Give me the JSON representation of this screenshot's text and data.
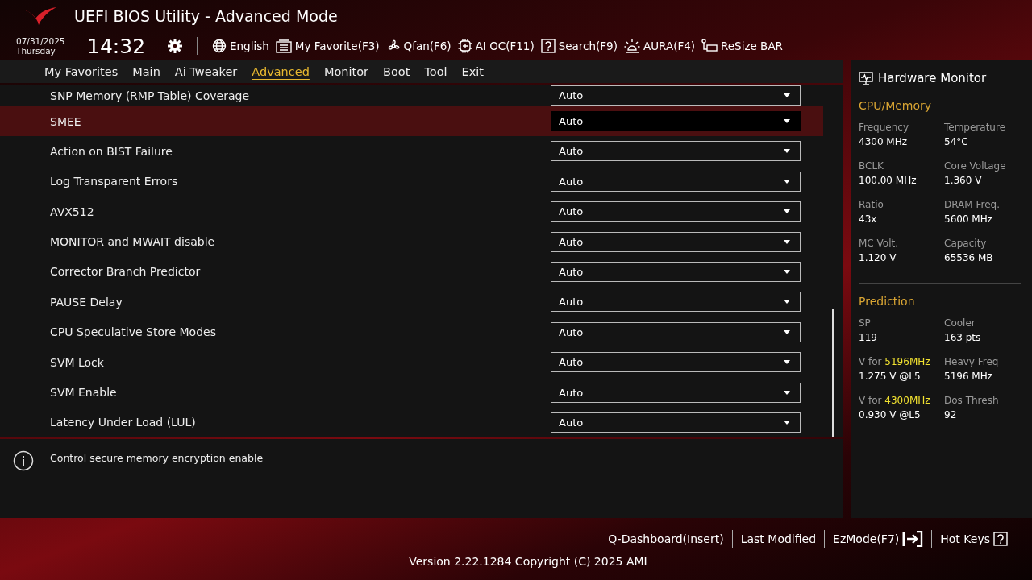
{
  "header": {
    "title": "UEFI BIOS Utility - Advanced Mode",
    "date": "07/31/2025",
    "day": "Thursday",
    "time": "14:32",
    "tools": [
      {
        "kind": "globe",
        "label": "English"
      },
      {
        "kind": "favorite",
        "label": "My Favorite(F3)"
      },
      {
        "kind": "fan",
        "label": "Qfan(F6)"
      },
      {
        "kind": "chip",
        "label": "AI OC(F11)"
      },
      {
        "kind": "help",
        "label": "Search(F9)"
      },
      {
        "kind": "light",
        "label": "AURA(F4)"
      },
      {
        "kind": "card",
        "label": "ReSize BAR"
      }
    ]
  },
  "tabs": [
    {
      "label": "My Favorites",
      "selected": false
    },
    {
      "label": "Main",
      "selected": false
    },
    {
      "label": "Ai Tweaker",
      "selected": false
    },
    {
      "label": "Advanced",
      "selected": true
    },
    {
      "label": "Monitor",
      "selected": false
    },
    {
      "label": "Boot",
      "selected": false
    },
    {
      "label": "Tool",
      "selected": false
    },
    {
      "label": "Exit",
      "selected": false
    }
  ],
  "settings": [
    {
      "label": "SNP Memory (RMP Table) Coverage",
      "value": "Auto",
      "selected": false
    },
    {
      "label": "SMEE",
      "value": "Auto",
      "selected": true
    },
    {
      "label": "Action on BIST Failure",
      "value": "Auto",
      "selected": false
    },
    {
      "label": "Log Transparent Errors",
      "value": "Auto",
      "selected": false
    },
    {
      "label": "AVX512",
      "value": "Auto",
      "selected": false
    },
    {
      "label": "MONITOR and MWAIT disable",
      "value": "Auto",
      "selected": false
    },
    {
      "label": "Corrector Branch Predictor",
      "value": "Auto",
      "selected": false
    },
    {
      "label": "PAUSE Delay",
      "value": "Auto",
      "selected": false
    },
    {
      "label": "CPU Speculative Store Modes",
      "value": "Auto",
      "selected": false
    },
    {
      "label": "SVM Lock",
      "value": "Auto",
      "selected": false
    },
    {
      "label": "SVM Enable",
      "value": "Auto",
      "selected": false
    },
    {
      "label": "Latency Under Load (LUL)",
      "value": "Auto",
      "selected": false
    }
  ],
  "help_text": "Control secure memory encryption enable",
  "hardware_monitor": {
    "title": "Hardware Monitor",
    "sections": [
      {
        "title": "CPU/Memory",
        "items": [
          {
            "label": "Frequency",
            "value": "4300 MHz"
          },
          {
            "label": "Temperature",
            "value": "54°C"
          },
          {
            "label": "BCLK",
            "value": "100.00 MHz"
          },
          {
            "label": "Core Voltage",
            "value": "1.360 V"
          },
          {
            "label": "Ratio",
            "value": "43x"
          },
          {
            "label": "DRAM Freq.",
            "value": "5600 MHz"
          },
          {
            "label": "MC Volt.",
            "value": "1.120 V"
          },
          {
            "label": "Capacity",
            "value": "65536 MB"
          }
        ]
      },
      {
        "title": "Prediction",
        "items": [
          {
            "label": "SP",
            "value": "119"
          },
          {
            "label": "Cooler",
            "value": "163 pts"
          },
          {
            "label": "V for **5196MHz**",
            "value": "1.275 V @L5"
          },
          {
            "label": "Heavy Freq",
            "value": "5196 MHz"
          },
          {
            "label": "V for **4300MHz**",
            "value": "0.930 V @L5"
          },
          {
            "label": "Dos Thresh",
            "value": "92"
          }
        ]
      }
    ]
  },
  "footer": {
    "links": [
      {
        "kind": "text",
        "label": "Q-Dashboard(Insert)"
      },
      {
        "kind": "text",
        "label": "Last Modified"
      },
      {
        "kind": "exit",
        "label": "EzMode(F7)"
      },
      {
        "kind": "help",
        "label": "Hot Keys"
      }
    ],
    "version": "Version 2.22.1284 Copyright (C) 2025 AMI"
  }
}
